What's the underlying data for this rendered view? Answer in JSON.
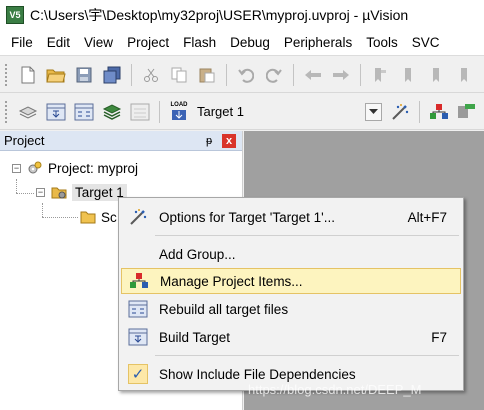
{
  "window": {
    "title": "C:\\Users\\宇\\Desktop\\my32proj\\USER\\myproj.uvproj - µVision",
    "app_icon_text": "V5"
  },
  "menubar": [
    "File",
    "Edit",
    "View",
    "Project",
    "Flash",
    "Debug",
    "Peripherals",
    "Tools",
    "SVC"
  ],
  "toolbar2": {
    "target_label": "Target 1",
    "load_icon_text": "LOAD"
  },
  "project_panel": {
    "title": "Project",
    "pin_glyph": "ᵽ",
    "close_glyph": "x",
    "tree": {
      "root_label": "Project: myproj",
      "target_label": "Target 1",
      "child_label_partial": "Sc"
    }
  },
  "context_menu": {
    "items": [
      {
        "label": "Options for Target 'Target 1'...",
        "shortcut": "Alt+F7",
        "icon": "magic-wand-icon"
      },
      {
        "label": "Add Group...",
        "shortcut": "",
        "icon": ""
      },
      {
        "label": "Manage Project Items...",
        "shortcut": "",
        "icon": "manage-project-items-icon",
        "highlighted": true
      },
      {
        "label": "Rebuild all target files",
        "shortcut": "",
        "icon": "rebuild-icon"
      },
      {
        "label": "Build Target",
        "shortcut": "F7",
        "icon": "build-icon"
      },
      {
        "label": "Show Include File Dependencies",
        "shortcut": "",
        "icon": "checkmark-icon",
        "checked": true
      }
    ]
  },
  "watermark": "https://blog.csdn.net/DEEP_M",
  "colors": {
    "panel_header": "#dde6f3",
    "editor_bg": "#a0a0a0",
    "highlight": "#fdf4bf",
    "close_button": "#d9342b"
  }
}
